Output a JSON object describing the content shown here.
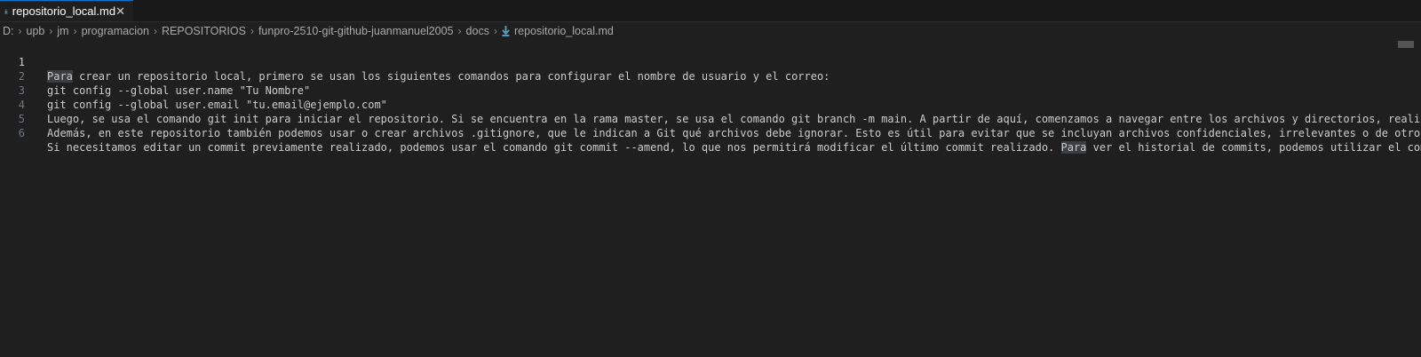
{
  "tab": {
    "filename": "repositorio_local.md",
    "close_glyph": "✕",
    "icon": "markdown-icon"
  },
  "breadcrumb": {
    "items": [
      "D:",
      "upb",
      "jm",
      "programacion",
      "REPOSITORIOS",
      "funpro-2510-git-github-juanmanuel2005",
      "docs",
      "repositorio_local.md"
    ],
    "separator": "›"
  },
  "editor": {
    "lines": [
      {
        "number": "1",
        "text_hl": "Para",
        "text": " crear un repositorio local, primero se usan los siguientes comandos para configurar el nombre de usuario y el correo:"
      },
      {
        "number": "2",
        "text": "git config --global user.name \"Tu Nombre\""
      },
      {
        "number": "3",
        "text": "git config --global user.email \"tu.email@ejemplo.com\""
      },
      {
        "number": "4",
        "text": "Luego, se usa el comando git init para iniciar el repositorio. Si se encuentra en la rama master, se usa el comando git branch -m main. A partir de aquí, comenzamos a navegar entre los archivos y directorios, realizan"
      },
      {
        "number": "5",
        "text": "Además, en este repositorio también podemos usar o crear archivos .gitignore, que le indican a Git qué archivos debe ignorar. Esto es útil para evitar que se incluyan archivos confidenciales, irrelevantes o de otro ti"
      },
      {
        "number": "6",
        "text_a": "Si necesitamos editar un commit previamente realizado, podemos usar el comando git commit --amend, lo que nos permitirá modificar el último commit realizado. ",
        "text_hl": "Para",
        "text_b": " ver el historial de commits, podemos utilizar el coman"
      }
    ]
  },
  "colors": {
    "background": "#1f1f1f",
    "tab_accent": "#0078d4",
    "markdown_icon": "#519aba"
  }
}
